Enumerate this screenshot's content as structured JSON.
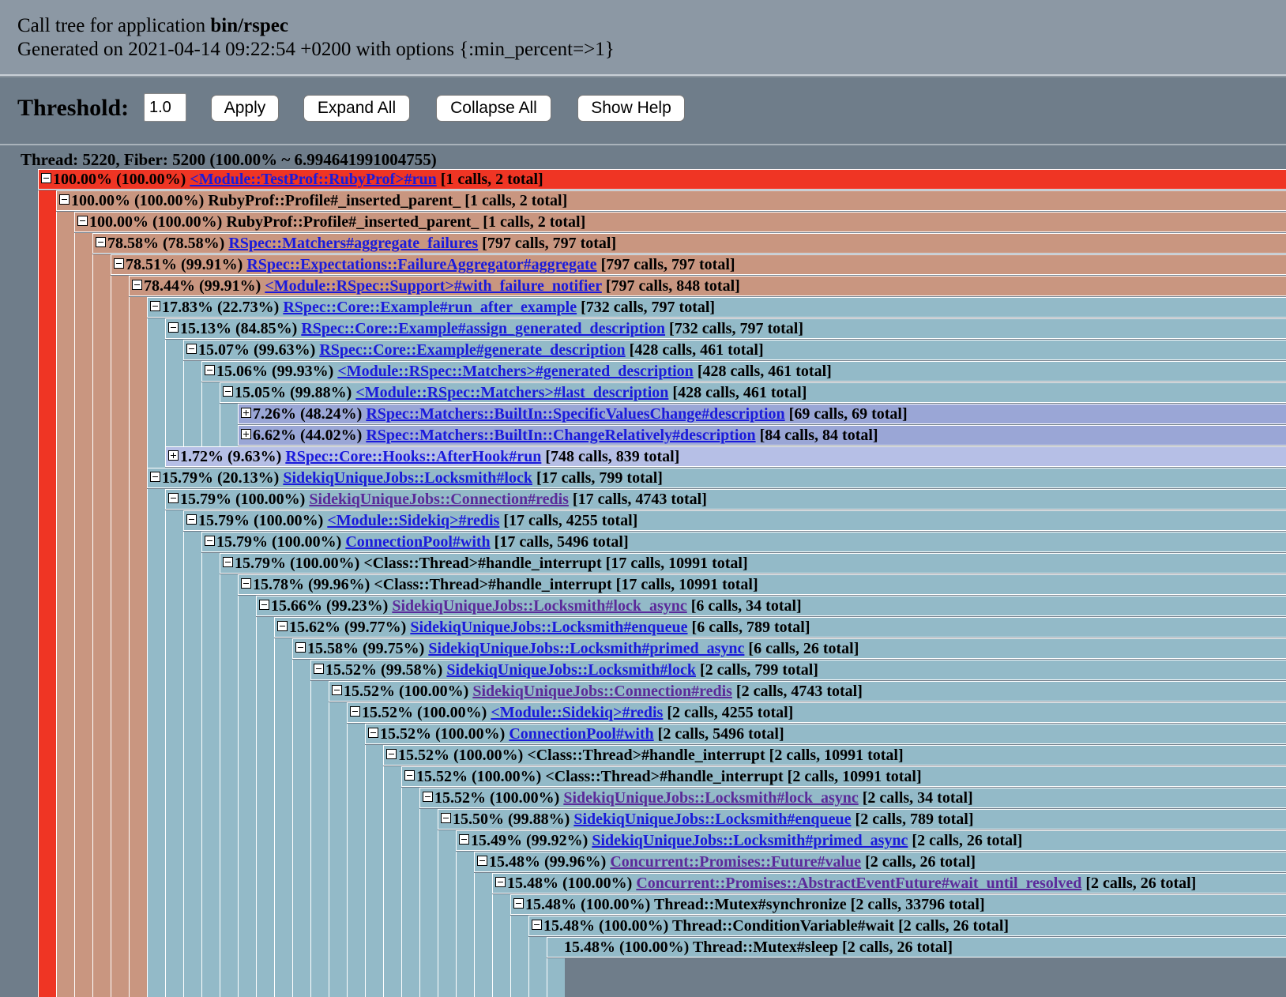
{
  "header": {
    "line1_prefix": "Call tree for application ",
    "app_name": "bin/rspec",
    "line2": "Generated on 2021-04-14 09:22:54 +0200 with options {:min_percent=>1}"
  },
  "toolbar": {
    "threshold_label": "Threshold:",
    "threshold_value": "1.0",
    "apply_label": "Apply",
    "expand_label": "Expand All",
    "collapse_label": "Collapse All",
    "help_label": "Show Help"
  },
  "colors": {
    "red": "#ef3524",
    "tan": "#c99680",
    "blue": "#93bac8",
    "lavender": "#9aa6d6",
    "light_lavender": "#b6bfe6",
    "link": "#1a1adb",
    "visited": "#5b2a9a"
  },
  "thread": {
    "title": "Thread: 5220, Fiber: 5200 (100.00% ~ 6.994641991004755)",
    "rows": [
      {
        "depth": 0,
        "toggle": "minus",
        "pct": "100.00%",
        "rel": "(100.00%)",
        "name": "<Module::TestProf::RubyProf>#run",
        "link": true,
        "calls": "[1 calls, 2 total]",
        "color": "red"
      },
      {
        "depth": 1,
        "toggle": "minus",
        "pct": "100.00%",
        "rel": "(100.00%)",
        "name": "RubyProf::Profile#_inserted_parent_",
        "link": false,
        "calls": "[1 calls, 2 total]",
        "color": "tan"
      },
      {
        "depth": 2,
        "toggle": "minus",
        "pct": "100.00%",
        "rel": "(100.00%)",
        "name": "RubyProf::Profile#_inserted_parent_",
        "link": false,
        "calls": "[1 calls, 2 total]",
        "color": "tan"
      },
      {
        "depth": 3,
        "toggle": "minus",
        "pct": "78.58%",
        "rel": "(78.58%)",
        "name": "RSpec::Matchers#aggregate_failures",
        "link": true,
        "calls": "[797 calls, 797 total]",
        "color": "tan"
      },
      {
        "depth": 4,
        "toggle": "minus",
        "pct": "78.51%",
        "rel": "(99.91%)",
        "name": "RSpec::Expectations::FailureAggregator#aggregate",
        "link": true,
        "calls": "[797 calls, 797 total]",
        "color": "tan"
      },
      {
        "depth": 5,
        "toggle": "minus",
        "pct": "78.44%",
        "rel": "(99.91%)",
        "name": "<Module::RSpec::Support>#with_failure_notifier",
        "link": true,
        "calls": "[797 calls, 848 total]",
        "color": "tan"
      },
      {
        "depth": 6,
        "toggle": "minus",
        "pct": "17.83%",
        "rel": "(22.73%)",
        "name": "RSpec::Core::Example#run_after_example",
        "link": true,
        "calls": "[732 calls, 797 total]",
        "color": "blue"
      },
      {
        "depth": 7,
        "toggle": "minus",
        "pct": "15.13%",
        "rel": "(84.85%)",
        "name": "RSpec::Core::Example#assign_generated_description",
        "link": true,
        "calls": "[732 calls, 797 total]",
        "color": "blue"
      },
      {
        "depth": 8,
        "toggle": "minus",
        "pct": "15.07%",
        "rel": "(99.63%)",
        "name": "RSpec::Core::Example#generate_description",
        "link": true,
        "calls": "[428 calls, 461 total]",
        "color": "blue"
      },
      {
        "depth": 9,
        "toggle": "minus",
        "pct": "15.06%",
        "rel": "(99.93%)",
        "name": "<Module::RSpec::Matchers>#generated_description",
        "link": true,
        "calls": "[428 calls, 461 total]",
        "color": "blue"
      },
      {
        "depth": 10,
        "toggle": "minus",
        "pct": "15.05%",
        "rel": "(99.88%)",
        "name": "<Module::RSpec::Matchers>#last_description",
        "link": true,
        "calls": "[428 calls, 461 total]",
        "color": "blue"
      },
      {
        "depth": 11,
        "toggle": "plus",
        "pct": "7.26%",
        "rel": "(48.24%)",
        "name": "RSpec::Matchers::BuiltIn::SpecificValuesChange#description",
        "link": true,
        "calls": "[69 calls, 69 total]",
        "color": "lavender"
      },
      {
        "depth": 11,
        "toggle": "plus",
        "pct": "6.62%",
        "rel": "(44.02%)",
        "name": "RSpec::Matchers::BuiltIn::ChangeRelatively#description",
        "link": true,
        "calls": "[84 calls, 84 total]",
        "color": "lavender"
      },
      {
        "depth": 7,
        "toggle": "plus",
        "pct": "1.72%",
        "rel": "(9.63%)",
        "name": "RSpec::Core::Hooks::AfterHook#run",
        "link": true,
        "calls": "[748 calls, 839 total]",
        "color": "light_lavender"
      },
      {
        "depth": 6,
        "toggle": "minus",
        "pct": "15.79%",
        "rel": "(20.13%)",
        "name": "SidekiqUniqueJobs::Locksmith#lock",
        "link": true,
        "calls": "[17 calls, 799 total]",
        "color": "blue"
      },
      {
        "depth": 7,
        "toggle": "minus",
        "pct": "15.79%",
        "rel": "(100.00%)",
        "name": "SidekiqUniqueJobs::Connection#redis",
        "link": true,
        "visited": true,
        "calls": "[17 calls, 4743 total]",
        "color": "blue"
      },
      {
        "depth": 8,
        "toggle": "minus",
        "pct": "15.79%",
        "rel": "(100.00%)",
        "name": "<Module::Sidekiq>#redis",
        "link": true,
        "calls": "[17 calls, 4255 total]",
        "color": "blue"
      },
      {
        "depth": 9,
        "toggle": "minus",
        "pct": "15.79%",
        "rel": "(100.00%)",
        "name": "ConnectionPool#with",
        "link": true,
        "calls": "[17 calls, 5496 total]",
        "color": "blue"
      },
      {
        "depth": 10,
        "toggle": "minus",
        "pct": "15.79%",
        "rel": "(100.00%)",
        "name": "<Class::Thread>#handle_interrupt",
        "link": false,
        "calls": "[17 calls, 10991 total]",
        "color": "blue"
      },
      {
        "depth": 11,
        "toggle": "minus",
        "pct": "15.78%",
        "rel": "(99.96%)",
        "name": "<Class::Thread>#handle_interrupt",
        "link": false,
        "calls": "[17 calls, 10991 total]",
        "color": "blue"
      },
      {
        "depth": 12,
        "toggle": "minus",
        "pct": "15.66%",
        "rel": "(99.23%)",
        "name": "SidekiqUniqueJobs::Locksmith#lock_async",
        "link": true,
        "visited": true,
        "calls": "[6 calls, 34 total]",
        "color": "blue"
      },
      {
        "depth": 13,
        "toggle": "minus",
        "pct": "15.62%",
        "rel": "(99.77%)",
        "name": "SidekiqUniqueJobs::Locksmith#enqueue",
        "link": true,
        "calls": "[6 calls, 789 total]",
        "color": "blue"
      },
      {
        "depth": 14,
        "toggle": "minus",
        "pct": "15.58%",
        "rel": "(99.75%)",
        "name": "SidekiqUniqueJobs::Locksmith#primed_async",
        "link": true,
        "calls": "[6 calls, 26 total]",
        "color": "blue"
      },
      {
        "depth": 15,
        "toggle": "minus",
        "pct": "15.52%",
        "rel": "(99.58%)",
        "name": "SidekiqUniqueJobs::Locksmith#lock",
        "link": true,
        "calls": "[2 calls, 799 total]",
        "color": "blue"
      },
      {
        "depth": 16,
        "toggle": "minus",
        "pct": "15.52%",
        "rel": "(100.00%)",
        "name": "SidekiqUniqueJobs::Connection#redis",
        "link": true,
        "visited": true,
        "calls": "[2 calls, 4743 total]",
        "color": "blue"
      },
      {
        "depth": 17,
        "toggle": "minus",
        "pct": "15.52%",
        "rel": "(100.00%)",
        "name": "<Module::Sidekiq>#redis",
        "link": true,
        "calls": "[2 calls, 4255 total]",
        "color": "blue"
      },
      {
        "depth": 18,
        "toggle": "minus",
        "pct": "15.52%",
        "rel": "(100.00%)",
        "name": "ConnectionPool#with",
        "link": true,
        "calls": "[2 calls, 5496 total]",
        "color": "blue"
      },
      {
        "depth": 19,
        "toggle": "minus",
        "pct": "15.52%",
        "rel": "(100.00%)",
        "name": "<Class::Thread>#handle_interrupt",
        "link": false,
        "calls": "[2 calls, 10991 total]",
        "color": "blue"
      },
      {
        "depth": 20,
        "toggle": "minus",
        "pct": "15.52%",
        "rel": "(100.00%)",
        "name": "<Class::Thread>#handle_interrupt",
        "link": false,
        "calls": "[2 calls, 10991 total]",
        "color": "blue"
      },
      {
        "depth": 21,
        "toggle": "minus",
        "pct": "15.52%",
        "rel": "(100.00%)",
        "name": "SidekiqUniqueJobs::Locksmith#lock_async",
        "link": true,
        "visited": true,
        "calls": "[2 calls, 34 total]",
        "color": "blue"
      },
      {
        "depth": 22,
        "toggle": "minus",
        "pct": "15.50%",
        "rel": "(99.88%)",
        "name": "SidekiqUniqueJobs::Locksmith#enqueue",
        "link": true,
        "calls": "[2 calls, 789 total]",
        "color": "blue"
      },
      {
        "depth": 23,
        "toggle": "minus",
        "pct": "15.49%",
        "rel": "(99.92%)",
        "name": "SidekiqUniqueJobs::Locksmith#primed_async",
        "link": true,
        "calls": "[2 calls, 26 total]",
        "color": "blue"
      },
      {
        "depth": 24,
        "toggle": "minus",
        "pct": "15.48%",
        "rel": "(99.96%)",
        "name": "Concurrent::Promises::Future#value",
        "link": true,
        "visited": true,
        "calls": "[2 calls, 26 total]",
        "color": "blue"
      },
      {
        "depth": 25,
        "toggle": "minus",
        "pct": "15.48%",
        "rel": "(100.00%)",
        "name": "Concurrent::Promises::AbstractEventFuture#wait_until_resolved",
        "link": true,
        "visited": true,
        "calls": "[2 calls, 26 total]",
        "color": "blue"
      },
      {
        "depth": 26,
        "toggle": "minus",
        "pct": "15.48%",
        "rel": "(100.00%)",
        "name": "Thread::Mutex#synchronize",
        "link": false,
        "calls": "[2 calls, 33796 total]",
        "color": "blue"
      },
      {
        "depth": 27,
        "toggle": "minus",
        "pct": "15.48%",
        "rel": "(100.00%)",
        "name": "Thread::ConditionVariable#wait",
        "link": false,
        "calls": "[2 calls, 26 total]",
        "color": "blue"
      },
      {
        "depth": 28,
        "toggle": "none",
        "pct": "15.48%",
        "rel": "(100.00%)",
        "name": "Thread::Mutex#sleep",
        "link": false,
        "calls": "[2 calls, 26 total]",
        "color": "blue"
      }
    ]
  }
}
